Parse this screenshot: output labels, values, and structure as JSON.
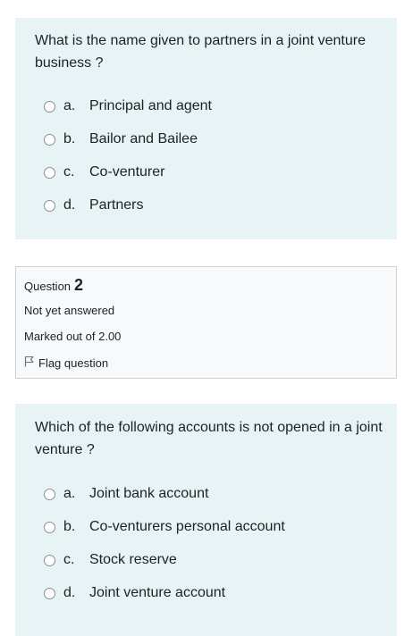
{
  "questions": [
    {
      "text": "What is the name given to partners in a joint venture business ?",
      "options": [
        {
          "letter": "a.",
          "label": "Principal and agent"
        },
        {
          "letter": "b.",
          "label": "Bailor and Bailee"
        },
        {
          "letter": "c.",
          "label": "Co-venturer"
        },
        {
          "letter": "d.",
          "label": "Partners"
        }
      ]
    },
    {
      "text": "Which of the following accounts is not opened in a joint venture ?",
      "options": [
        {
          "letter": "a.",
          "label": "Joint bank account"
        },
        {
          "letter": "b.",
          "label": "Co-venturers personal account"
        },
        {
          "letter": "c.",
          "label": "Stock reserve"
        },
        {
          "letter": "d.",
          "label": "Joint venture account"
        }
      ]
    }
  ],
  "info": {
    "question_word": "Question",
    "question_number": "2",
    "state": "Not yet answered",
    "grade": "Marked out of 2.00",
    "flag_label": "Flag question",
    "flag_icon": "flag-outline-icon"
  },
  "colors": {
    "question_bg": "#e7f3f5",
    "info_bg": "#f8f9fa",
    "text": "#1d2125"
  }
}
